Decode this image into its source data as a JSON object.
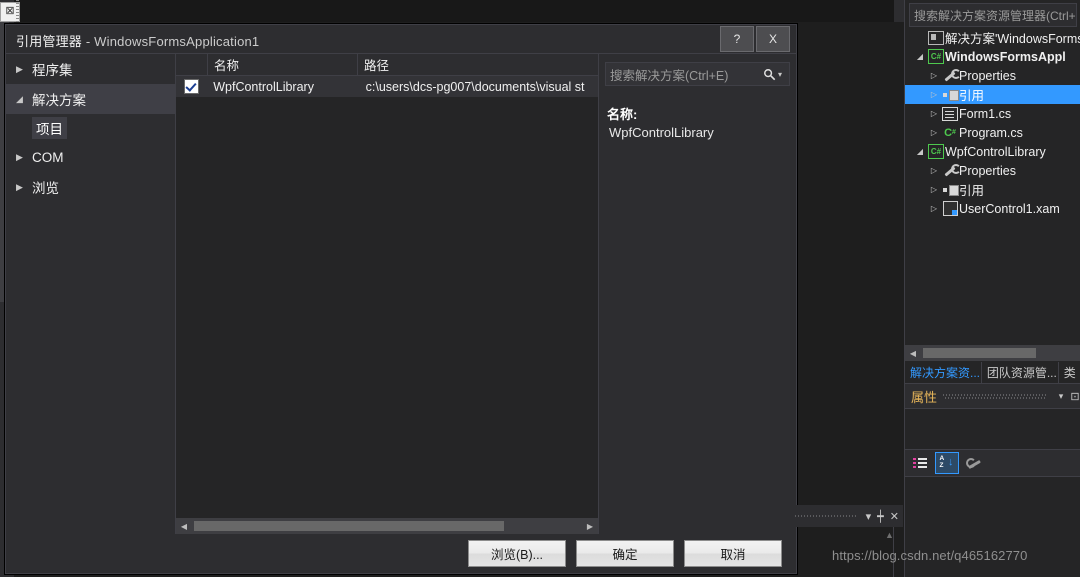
{
  "dialog": {
    "title_main": "引用管理器",
    "title_sep": " - ",
    "title_project": "WindowsFormsApplication1",
    "help_button": "?",
    "close_button": "X",
    "categories": [
      {
        "label": "程序集",
        "arrow": "▶",
        "selected": false,
        "sub": false
      },
      {
        "label": "解决方案",
        "arrow": "◢",
        "selected": true,
        "sub": false
      },
      {
        "label": "项目",
        "arrow": "",
        "selected": false,
        "sub": true
      },
      {
        "label": "COM",
        "arrow": "▶",
        "selected": false,
        "sub": false
      },
      {
        "label": "浏览",
        "arrow": "▶",
        "selected": false,
        "sub": false
      }
    ],
    "list": {
      "headers": {
        "check": "",
        "name": "名称",
        "path": "路径"
      },
      "rows": [
        {
          "checked": true,
          "name": "WpfControlLibrary",
          "path": "c:\\users\\dcs-pg007\\documents\\visual st"
        }
      ]
    },
    "search": {
      "placeholder": "搜索解决方案(Ctrl+E)",
      "icon": "search-icon",
      "caret": "▾"
    },
    "detail": {
      "label": "名称:",
      "value": "WpfControlLibrary"
    },
    "buttons": {
      "browse": "浏览(B)...",
      "ok": "确定",
      "cancel": "取消"
    }
  },
  "solution_explorer": {
    "search_placeholder": "搜索解决方案资源管理器(Ctrl+",
    "tree": [
      {
        "level": 1,
        "expander": "",
        "icon": "solution-icon",
        "label": "解决方案'WindowsForms",
        "bold": false,
        "selected": false
      },
      {
        "level": 1,
        "expander": "◢",
        "icon": "csharp-project-icon",
        "label": "WindowsFormsAppl",
        "bold": true,
        "selected": false
      },
      {
        "level": 2,
        "expander": "▷",
        "icon": "wrench-icon",
        "label": "Properties",
        "bold": false,
        "selected": false
      },
      {
        "level": 2,
        "expander": "▷",
        "icon": "references-icon",
        "label": "引用",
        "bold": false,
        "selected": true
      },
      {
        "level": 2,
        "expander": "▷",
        "icon": "form-icon",
        "label": "Form1.cs",
        "bold": false,
        "selected": false
      },
      {
        "level": 2,
        "expander": "▷",
        "icon": "csharp-file-icon",
        "label": "Program.cs",
        "bold": false,
        "selected": false
      },
      {
        "level": 1,
        "expander": "◢",
        "icon": "csharp-project-icon",
        "label": "WpfControlLibrary",
        "bold": false,
        "selected": false
      },
      {
        "level": 2,
        "expander": "▷",
        "icon": "wrench-icon",
        "label": "Properties",
        "bold": false,
        "selected": false
      },
      {
        "level": 2,
        "expander": "▷",
        "icon": "references-icon",
        "label": "引用",
        "bold": false,
        "selected": false
      },
      {
        "level": 2,
        "expander": "▷",
        "icon": "xaml-icon",
        "label": "UserControl1.xam",
        "bold": false,
        "selected": false
      }
    ],
    "tabs": [
      {
        "label": "解决方案资...",
        "active": true
      },
      {
        "label": "团队资源管...",
        "active": false
      },
      {
        "label": "类",
        "active": false
      }
    ]
  },
  "properties": {
    "title": "属性",
    "caret": "▾",
    "pin": "⊡",
    "toolbar": [
      {
        "icon": "categorized-icon",
        "active": false
      },
      {
        "icon": "alphabetical-sort-icon",
        "active": true
      },
      {
        "icon": "property-pages-icon",
        "active": false
      }
    ]
  },
  "float_bar": {
    "caret": "▾",
    "pin": "┿",
    "close": "✕"
  },
  "watermark": "https://blog.csdn.net/q465162770",
  "colors": {
    "accent_blue": "#3399ff",
    "panel_bg": "#252526",
    "chrome_bg": "#2d2d30",
    "list_bg": "#333337",
    "props_title": "#e8b65a"
  }
}
